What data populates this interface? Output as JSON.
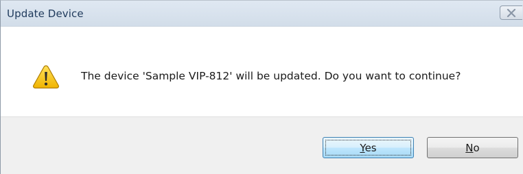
{
  "window": {
    "title": "Update Device",
    "close_icon": "close-x-icon"
  },
  "message": {
    "icon": "warning-icon",
    "text": "The device 'Sample VIP-812' will be updated.  Do you want to continue?"
  },
  "buttons": {
    "yes": {
      "accel": "Y",
      "rest": "es"
    },
    "no": {
      "accel": "N",
      "rest": "o"
    }
  },
  "colors": {
    "titlebar": "#dfe8f2",
    "title_text": "#1e395b",
    "footer": "#f0f0f0",
    "default_button_border": "#3c7fb1",
    "warning_fill": "#f5c400"
  }
}
